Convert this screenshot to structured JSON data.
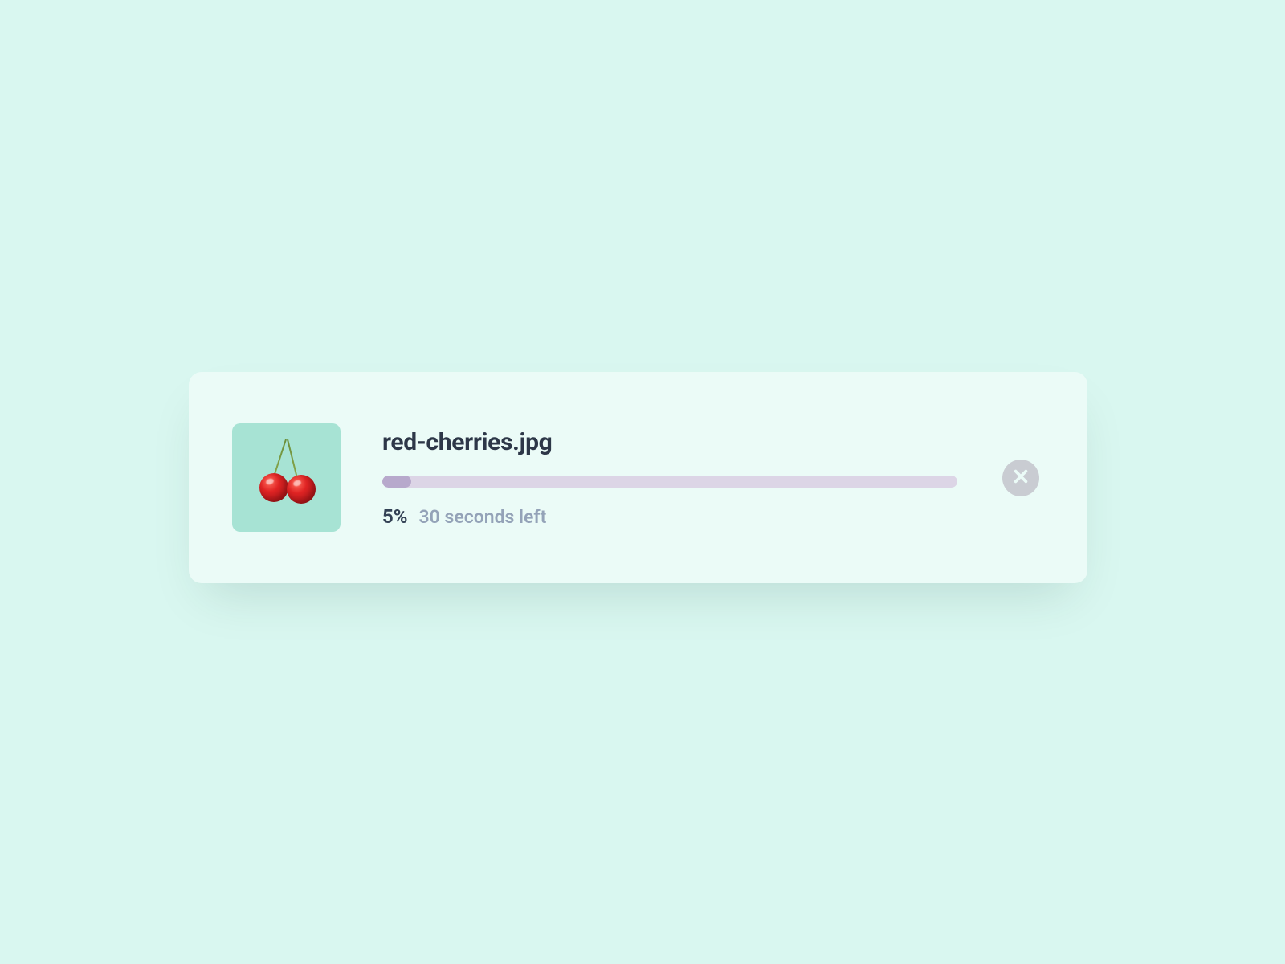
{
  "upload": {
    "filename": "red-cherries.jpg",
    "progress_percent": 5,
    "progress_label": "5%",
    "time_remaining": "30 seconds left",
    "thumbnail_alt": "red cherries on mint background",
    "colors": {
      "page_bg": "#d9f7f0",
      "card_bg": "#ebfbf7",
      "track": "#dcd5e6",
      "text_primary": "#2d3748",
      "text_secondary": "#94a3b8",
      "cancel_bg": "#c9ccd2"
    }
  }
}
